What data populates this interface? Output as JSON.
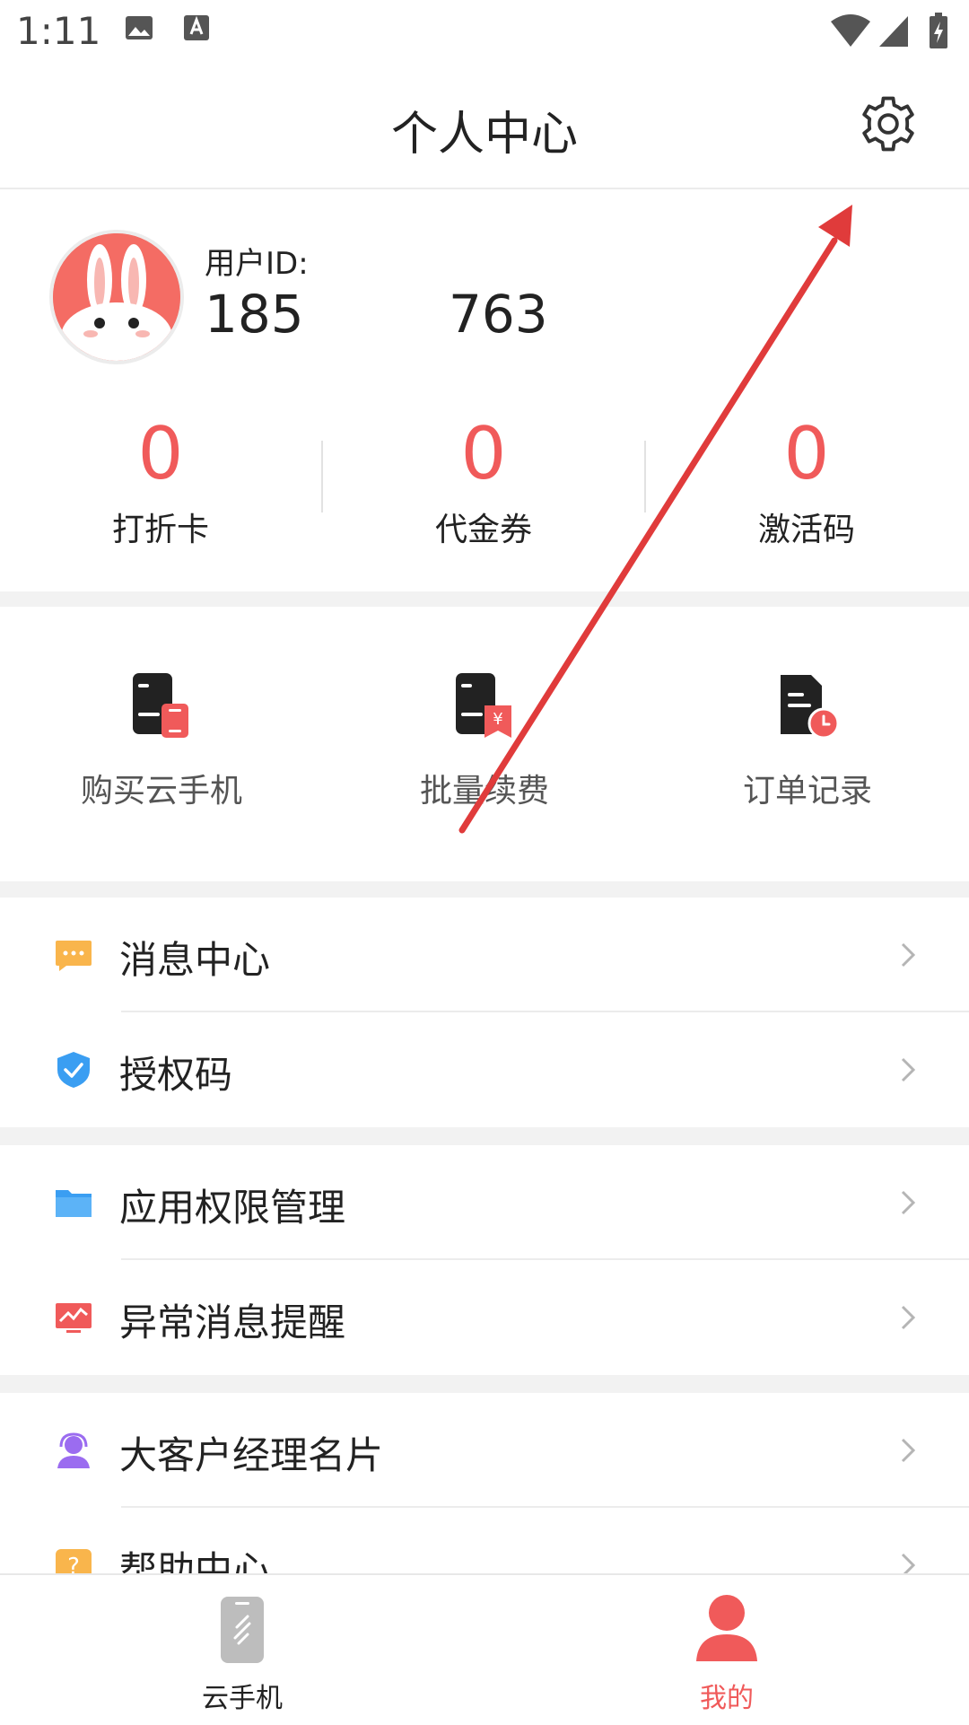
{
  "status_bar": {
    "time": "1:11"
  },
  "header": {
    "title": "个人中心"
  },
  "profile": {
    "user_id_label": "用户ID:",
    "user_id_part1": "185",
    "user_id_part2": "763"
  },
  "stats": [
    {
      "value": "0",
      "label": "打折卡"
    },
    {
      "value": "0",
      "label": "代金券"
    },
    {
      "value": "0",
      "label": "激活码"
    }
  ],
  "actions": [
    {
      "label": "购买云手机"
    },
    {
      "label": "批量续费"
    },
    {
      "label": "订单记录"
    }
  ],
  "menu": {
    "message_center": "消息中心",
    "auth_code": "授权码",
    "app_permissions": "应用权限管理",
    "abnormal_alert": "异常消息提醒",
    "account_manager_card": "大客户经理名片",
    "help_center": "帮助中心"
  },
  "tabbar": {
    "cloud_phone": "云手机",
    "mine": "我的"
  },
  "colors": {
    "accent": "#f05a5a",
    "message_icon": "#f9b54c",
    "auth_icon": "#3a9ef2",
    "folder_icon": "#3a9ef2",
    "monitor_icon": "#f05a5a",
    "manager_icon": "#9b6cf0",
    "help_icon": "#f9b54c",
    "annotation_arrow": "#e03b3b"
  }
}
